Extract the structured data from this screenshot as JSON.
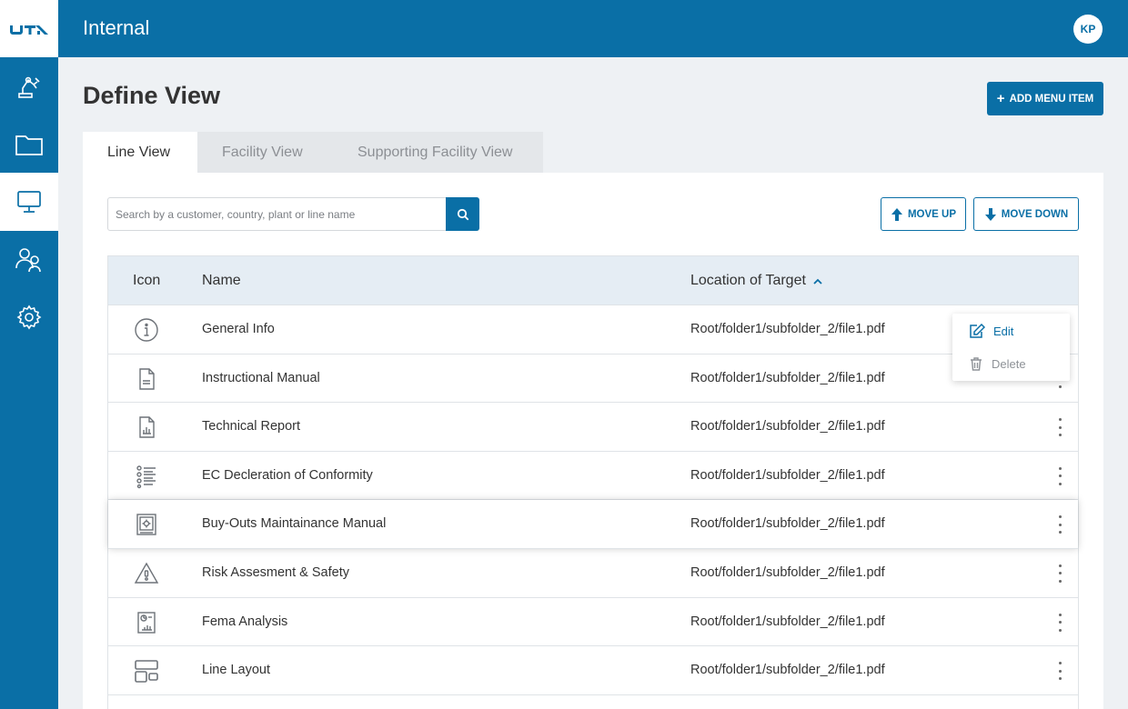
{
  "app": {
    "title": "Internal",
    "user_initials": "KP",
    "brand_color": "#0a6fa6"
  },
  "sidebar": {
    "items": [
      {
        "icon": "robot-arm-icon",
        "active": false
      },
      {
        "icon": "folder-icon",
        "active": false
      },
      {
        "icon": "monitor-icon",
        "active": true
      },
      {
        "icon": "users-icon",
        "active": false
      },
      {
        "icon": "gear-icon",
        "active": false
      }
    ]
  },
  "page": {
    "title": "Define View",
    "add_button_label": "ADD MENU ITEM"
  },
  "tabs": [
    {
      "label": "Line View",
      "active": true
    },
    {
      "label": "Facility View",
      "active": false
    },
    {
      "label": "Supporting Facility View",
      "active": false
    }
  ],
  "search": {
    "placeholder": "Search by a customer, country, plant or line name",
    "value": ""
  },
  "toolbar": {
    "move_up_label": "MOVE UP",
    "move_down_label": "MOVE DOWN"
  },
  "table": {
    "columns": [
      "Icon",
      "Name",
      "Location of Target"
    ],
    "sort": {
      "column": "Location of Target",
      "direction": "ascending"
    },
    "rows": [
      {
        "icon": "info-icon",
        "name": "General Info",
        "location": "Root/folder1/subfolder_2/file1.pdf"
      },
      {
        "icon": "document-icon",
        "name": "Instructional Manual",
        "location": "Root/folder1/subfolder_2/file1.pdf"
      },
      {
        "icon": "report-chart-icon",
        "name": "Technical Report",
        "location": "Root/folder1/subfolder_2/file1.pdf"
      },
      {
        "icon": "checklist-icon",
        "name": "EC Decleration of Conformity",
        "location": "Root/folder1/subfolder_2/file1.pdf"
      },
      {
        "icon": "manual-gear-icon",
        "name": "Buy-Outs Maintainance Manual",
        "location": "Root/folder1/subfolder_2/file1.pdf"
      },
      {
        "icon": "warning-icon",
        "name": "Risk Assesment & Safety",
        "location": "Root/folder1/subfolder_2/file1.pdf"
      },
      {
        "icon": "analysis-icon",
        "name": "Fema Analysis",
        "location": "Root/folder1/subfolder_2/file1.pdf"
      },
      {
        "icon": "layout-icon",
        "name": "Line Layout",
        "location": "Root/folder1/subfolder_2/file1.pdf"
      }
    ]
  },
  "context_menu": {
    "edit_label": "Edit",
    "delete_label": "Delete"
  }
}
